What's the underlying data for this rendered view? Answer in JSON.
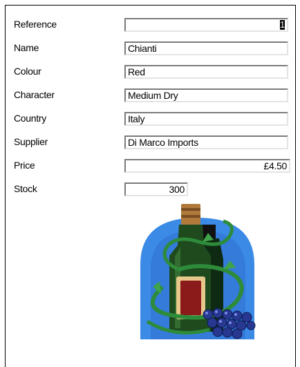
{
  "form": {
    "fields": [
      {
        "label": "Reference",
        "value": "1",
        "caret": true
      },
      {
        "label": "Name",
        "value": "Chianti"
      },
      {
        "label": "Colour",
        "value": "Red"
      },
      {
        "label": "Character",
        "value": "Medium Dry"
      },
      {
        "label": "Country",
        "value": "Italy"
      },
      {
        "label": "Supplier",
        "value": "Di Marco Imports"
      },
      {
        "label": "Price",
        "value": "£4.50"
      },
      {
        "label": "Stock",
        "value": "300"
      }
    ]
  },
  "image": {
    "icon": "wine-bottle-grapes-icon",
    "colors": {
      "sky": "#3a8ae6",
      "bottle": "#1e4a1e",
      "label": "#8b1a1a",
      "grapes": "#283890",
      "vine": "#2e8b3a"
    }
  }
}
